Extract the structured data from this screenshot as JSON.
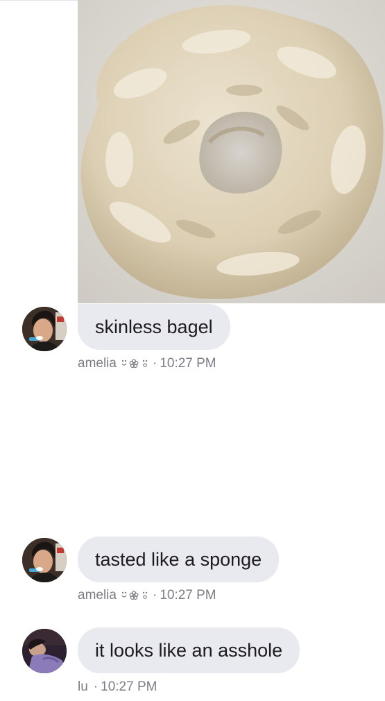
{
  "messages": [
    {
      "sender": "amelia",
      "text": "skinless bagel",
      "time": "10:27 PM",
      "decoration_icon": "flower-emoji-icon",
      "has_image": true,
      "image_subject": "bagel-photo"
    },
    {
      "sender": "amelia",
      "text": "tasted like a sponge",
      "time": "10:27 PM",
      "decoration_icon": "flower-emoji-icon",
      "has_image": false
    },
    {
      "sender": "lu",
      "text": "it looks like an asshole",
      "time": "10:27 PM",
      "has_image": false
    }
  ],
  "separator": "·",
  "colors": {
    "bubble": "#e9e9f0",
    "meta_text": "#7c7c86",
    "message_text": "#1c1c1e",
    "background": "#ffffff"
  }
}
